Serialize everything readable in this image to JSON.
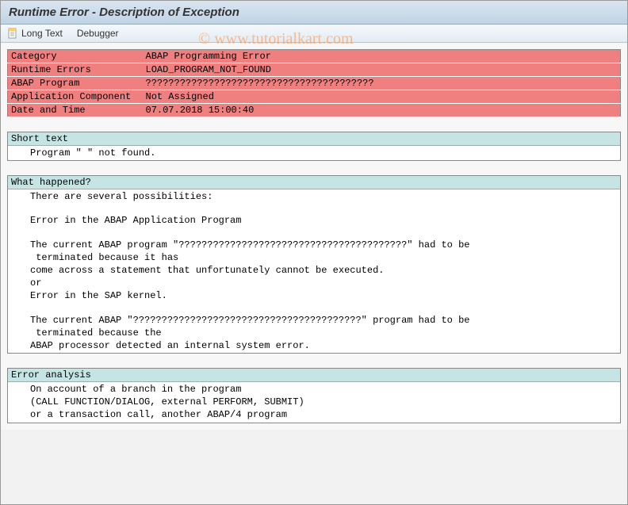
{
  "title": "Runtime Error - Description of Exception",
  "toolbar": {
    "long_text_label": "Long Text",
    "debugger_label": "Debugger"
  },
  "watermark": "© www.tutorialkart.com",
  "error_info": {
    "rows": [
      {
        "label": "Category",
        "value": "ABAP Programming Error"
      },
      {
        "label": "Runtime Errors",
        "value": "LOAD_PROGRAM_NOT_FOUND"
      },
      {
        "label": "ABAP Program",
        "value": "????????????????????????????????????????"
      },
      {
        "label": "Application Component",
        "value": "Not Assigned"
      },
      {
        "label": "Date and Time",
        "value": "07.07.2018 15:00:40"
      }
    ]
  },
  "sections": [
    {
      "header": "Short text",
      "lines": [
        "Program \" \" not found."
      ]
    },
    {
      "header": "What happened?",
      "lines": [
        "There are several possibilities:",
        "",
        "Error in the ABAP Application Program",
        "",
        "The current ABAP program \"????????????????????????????????????????\" had to be",
        " terminated because it has",
        "come across a statement that unfortunately cannot be executed.",
        "or",
        "Error in the SAP kernel.",
        "",
        "The current ABAP \"????????????????????????????????????????\" program had to be",
        " terminated because the",
        "ABAP processor detected an internal system error."
      ]
    },
    {
      "header": "Error analysis",
      "lines": [
        "On account of a branch in the program",
        "(CALL FUNCTION/DIALOG, external PERFORM, SUBMIT)",
        "or a transaction call, another ABAP/4 program"
      ]
    }
  ]
}
